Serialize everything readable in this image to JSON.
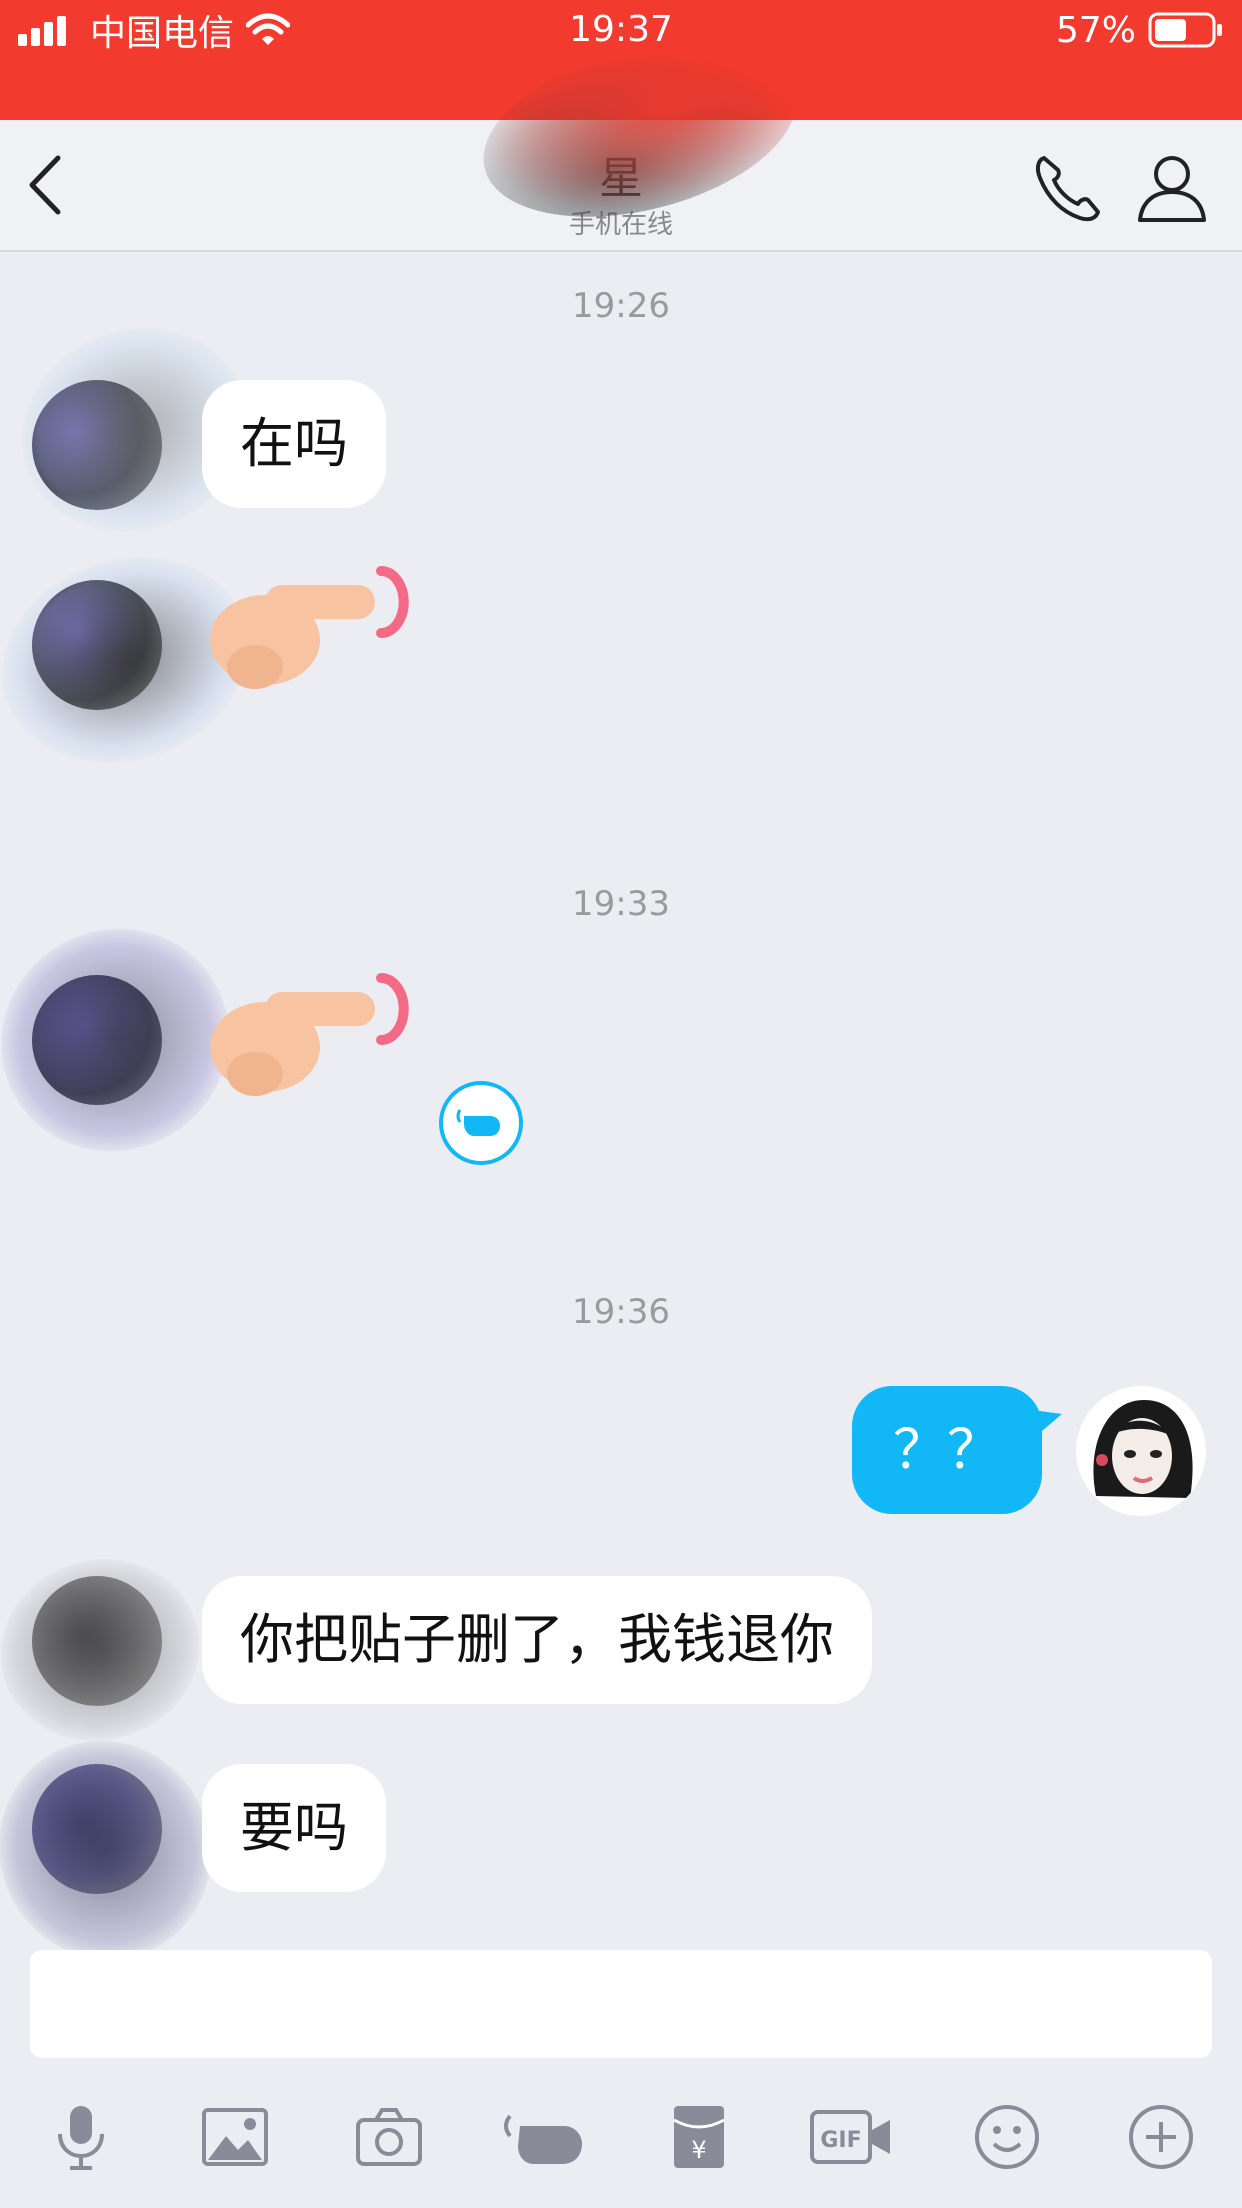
{
  "status_bar": {
    "carrier": "中国电信",
    "time": "19:37",
    "battery": "57%",
    "battery_level": 0.57
  },
  "header": {
    "title": "星",
    "subtitle": "手机在线"
  },
  "messages": {
    "ts1": "19:26",
    "m1": "在吗",
    "ts2": "19:33",
    "ts3": "19:36",
    "m_out": "？？",
    "m3": "你把贴子删了，我钱退你",
    "m4": "要吗"
  },
  "input": {
    "placeholder": ""
  },
  "toolbar": {
    "icons": [
      "microphone-icon",
      "image-icon",
      "camera-icon",
      "poke-icon",
      "red-packet-icon",
      "gif-icon",
      "emoji-icon",
      "plus-icon"
    ]
  },
  "colors": {
    "status_bar": "#f33a2e",
    "bubble_out": "#12b7f5",
    "background": "#ebedf2"
  }
}
